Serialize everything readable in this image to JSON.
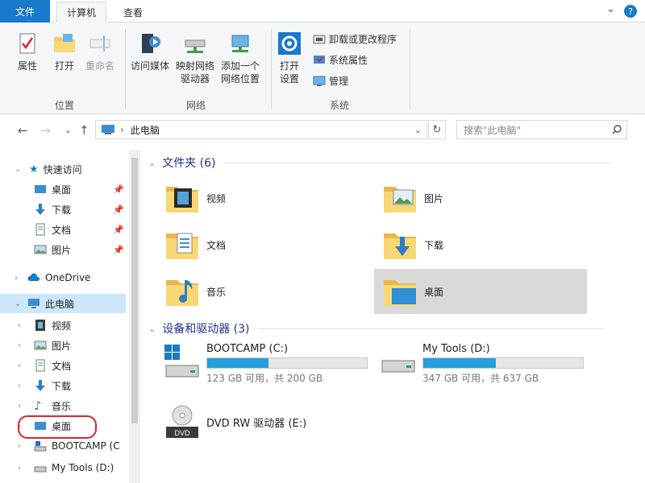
{
  "tabs": {
    "file": "文件",
    "computer": "计算机",
    "view": "查看"
  },
  "window_controls": {
    "collapse": "⌄",
    "help": "?"
  },
  "ribbon": {
    "location": {
      "properties": "属性",
      "open": "打开",
      "rename": "重命名",
      "group": "位置"
    },
    "network": {
      "media": "访问媒体",
      "map_drive": "映射网络\n驱动器",
      "add_location": "添加一个\n网络位置",
      "group": "网络"
    },
    "system": {
      "open_settings": "打开\n设置",
      "uninstall": "卸载或更改程序",
      "sys_props": "系统属性",
      "manage": "管理",
      "group": "系统"
    }
  },
  "nav": {
    "back": "←",
    "forward": "→",
    "recent": "⌄",
    "up": "↑",
    "breadcrumb": "此电脑",
    "dropdown": "⌄",
    "refresh": "↻",
    "search_placeholder": "搜索\"此电脑\""
  },
  "sidebar": {
    "quick_access": "快速访问",
    "qa_items": [
      "桌面",
      "下载",
      "文档",
      "图片"
    ],
    "onedrive": "OneDrive",
    "this_pc": "此电脑",
    "pc_items": [
      "视频",
      "图片",
      "文档",
      "下载",
      "音乐",
      "桌面",
      "BOOTCAMP (C",
      "My Tools (D:)"
    ]
  },
  "folders_header": "文件夹 (6)",
  "folders": [
    "视频",
    "图片",
    "文档",
    "下载",
    "音乐",
    "桌面"
  ],
  "devices_header": "设备和驱动器 (3)",
  "drives": [
    {
      "name": "BOOTCAMP (C:)",
      "info": "123 GB 可用，共 200 GB",
      "used_fraction": 0.385
    },
    {
      "name": "My Tools (D:)",
      "info": "347 GB 可用，共 637 GB",
      "used_fraction": 0.455
    },
    {
      "name": "DVD RW 驱动器 (E:)"
    }
  ],
  "colors": {
    "accent": "#1979ca",
    "selection": "#cce8ff",
    "drive_fill": "#26a0da",
    "folder": "#f3c966"
  }
}
